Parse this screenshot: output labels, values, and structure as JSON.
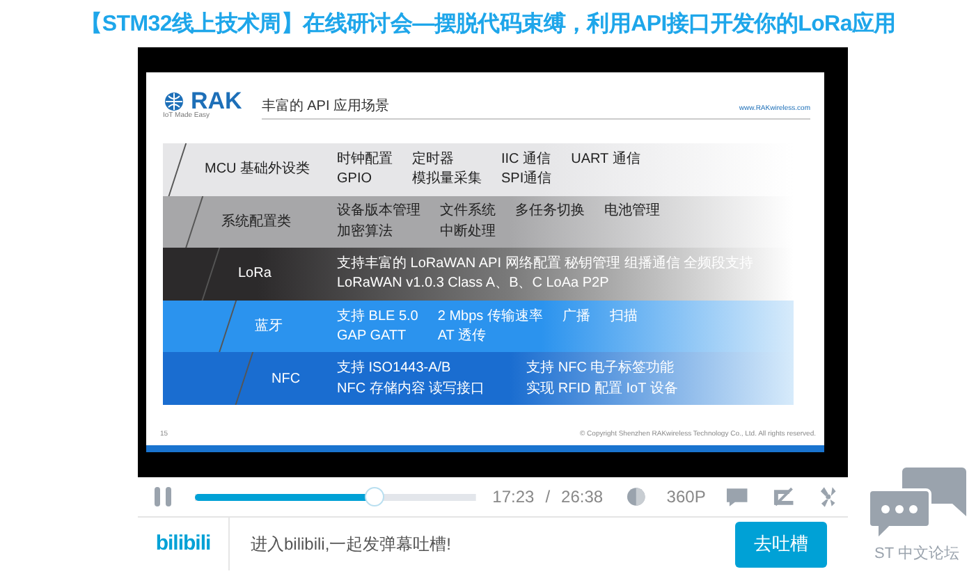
{
  "title": "【STM32线上技术周】在线研讨会—摆脱代码束缚，利用API接口开发你的LoRa应用",
  "slide": {
    "brand": "RAK",
    "tagline": "IoT Made Easy",
    "heading": "丰富的 API 应用场景",
    "url": "www.RAKwireless.com",
    "rows": [
      {
        "kind": "light",
        "category": "MCU 基础外设类",
        "lines": [
          [
            "时钟配置",
            "定时器",
            "IIC 通信",
            "UART 通信"
          ],
          [
            "GPIO",
            "模拟量采集",
            "SPI通信"
          ]
        ]
      },
      {
        "kind": "mid",
        "category": "系统配置类",
        "lines": [
          [
            "设备版本管理",
            "文件系统",
            "多任务切换",
            "电池管理"
          ],
          [
            "加密算法",
            "中断处理"
          ]
        ]
      },
      {
        "kind": "dark",
        "category": "LoRa",
        "lines": [
          [
            "支持丰富的 LoRaWAN API 网络配置  秘钥管理  组播通信 全频段支持"
          ],
          [
            "LoRaWAN  v1.0.3  Class A、B、C   LoAa P2P"
          ]
        ]
      },
      {
        "kind": "blue",
        "category": "蓝牙",
        "lines": [
          [
            "支持 BLE 5.0",
            "2 Mbps 传输速率",
            "广播",
            "扫描"
          ],
          [
            "GAP GATT",
            "AT 透传"
          ]
        ]
      },
      {
        "kind": "deepblue",
        "category": "NFC",
        "lines": [
          [
            "支持 ISO1443-A/B",
            "支持 NFC 电子标签功能"
          ],
          [
            "NFC 存储内容 读写接口",
            "实现 RFID 配置 IoT 设备"
          ]
        ]
      }
    ],
    "page": "15",
    "copyright": "© Copyright Shenzhen RAKwireless Technology Co., Ltd. All rights reserved."
  },
  "player": {
    "playing": true,
    "level": 0.64,
    "time": "17:23",
    "separator": "/",
    "duration": "26:38",
    "quality": "360P"
  },
  "comment_bar": {
    "logo": "bilibili",
    "placeholder": "进入bilibili,一起发弹幕吐槽!",
    "button": "去吐槽"
  },
  "forum": {
    "label": "ST 中文论坛"
  }
}
